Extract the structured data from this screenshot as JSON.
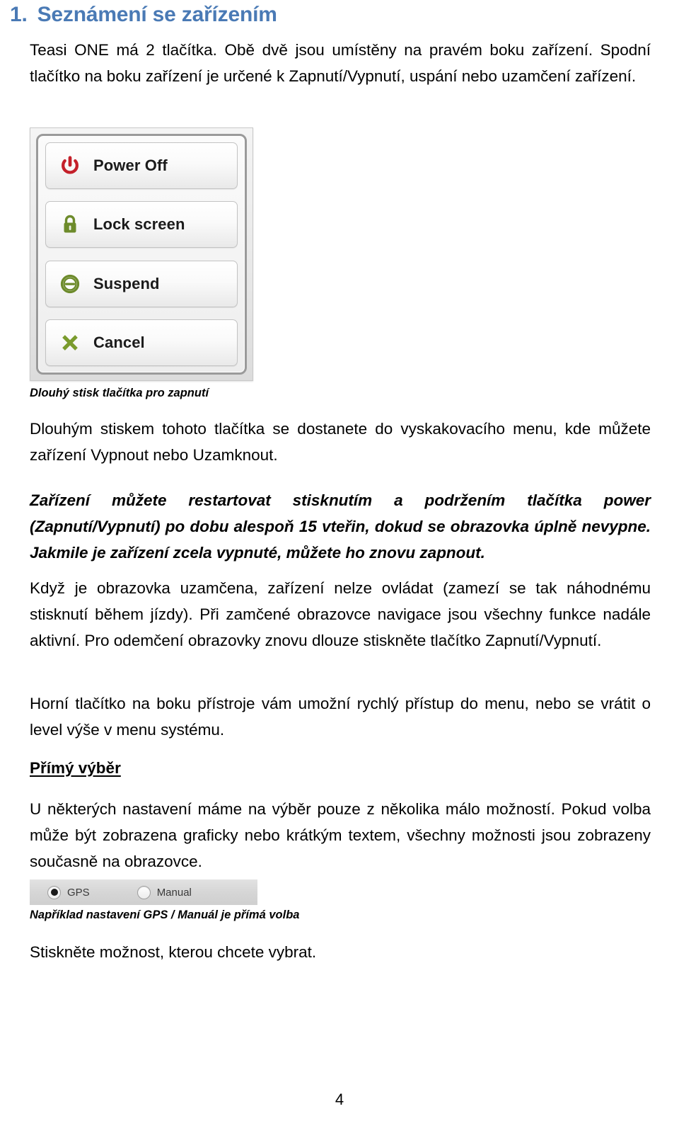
{
  "heading": {
    "number": "1.",
    "title": "Seznámení se zařízením",
    "color": "#4a7ab5"
  },
  "paragraphs": {
    "intro": "Teasi ONE má 2 tlačítka. Obě dvě jsou umístěny na pravém boku zařízení. Spodní tlačítko na boku zařízení je určené k Zapnutí/Vypnutí, uspání nebo uzamčení zařízení.",
    "after_image": "Dlouhým stiskem tohoto tlačítka se dostanete do vyskakovacího menu, kde můžete zařízení Vypnout nebo Uzamknout.",
    "restart_bold": "Zařízení můžete restartovat stisknutím a podržením tlačítka power (Zapnutí/Vypnutí) po dobu alespoň 15 vteřin, dokud se obrazovka úplně nevypne. Jakmile je zařízení zcela vypnuté, můžete ho znovu zapnout.",
    "locked_screen": "Když je obrazovka uzamčena, zařízení nelze ovládat (zamezí se tak náhodnému stisknutí během jízdy). Při zamčené obrazovce navigace jsou všechny funkce nadále aktivní. Pro odemčení obrazovky znovu dlouze stiskněte tlačítko Zapnutí/Vypnutí.",
    "top_button": "Horní tlačítko na boku přístroje vám umožní rychlý přístup do menu, nebo se vrátit o level výše v menu systému.",
    "direct_choice": "U některých nastavení máme na výběr pouze z několika málo možností. Pokud volba může být zobrazena graficky nebo krátkým textem, všechny možnosti jsou zobrazeny současně na obrazovce.",
    "press_option": "Stiskněte možnost, kterou chcete vybrat."
  },
  "captions": {
    "power_menu": "Dlouhý stisk tlačítka pro zapnutí",
    "gps_manual": "Například nastavení GPS / Manuál je přímá volba"
  },
  "subheading": {
    "direct_choice": "Přímý výběr"
  },
  "power_menu": {
    "items": [
      {
        "label": "Power Off",
        "icon": "power-icon",
        "color": "#c4202a"
      },
      {
        "label": "Lock screen",
        "icon": "lock-icon",
        "color": "#6d8b2b"
      },
      {
        "label": "Suspend",
        "icon": "suspend-icon",
        "color": "#6d8b2b"
      },
      {
        "label": "Cancel",
        "icon": "close-icon",
        "color": "#7a9b2d"
      }
    ]
  },
  "radio_group": {
    "options": [
      {
        "label": "GPS",
        "selected": true
      },
      {
        "label": "Manual",
        "selected": false
      }
    ]
  },
  "footer": {
    "page_number": "4"
  }
}
